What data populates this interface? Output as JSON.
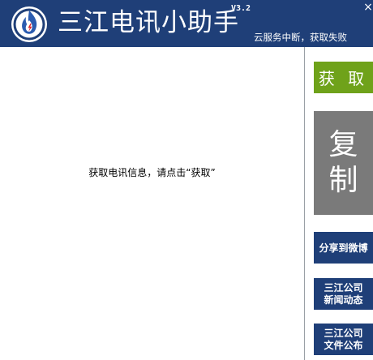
{
  "app": {
    "title": "三江电讯小助手",
    "version": "V3.2",
    "status": "云服务中断，获取失败",
    "close_label": "×"
  },
  "main": {
    "message": "获取电讯信息，请点击“获取”"
  },
  "sidebar": {
    "fetch_label": "获 取",
    "copy_line1": "复",
    "copy_line2": "制",
    "weibo_label": "分享到微博",
    "news_line1": "三江公司",
    "news_line2": "新闻动态",
    "docs_line1": "三江公司",
    "docs_line2": "文件公布"
  },
  "colors": {
    "titlebar": "#1f3f78",
    "fetch_button": "#6fa21a",
    "copy_button": "#7a7a7a",
    "nav_button": "#1f3f78"
  },
  "icons": {
    "logo": "flame-emblem-icon",
    "close": "close-icon"
  }
}
